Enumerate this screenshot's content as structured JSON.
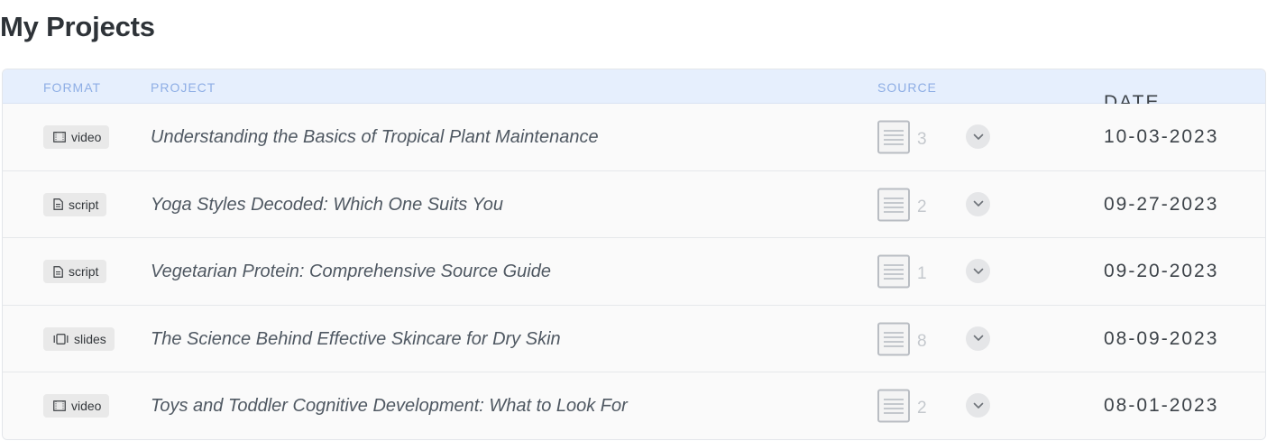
{
  "page": {
    "title": "My Projects"
  },
  "table": {
    "headers": {
      "format": "FORMAT",
      "project": "PROJECT",
      "source": "SOURCE",
      "date": "DATE"
    },
    "rows": [
      {
        "format": "video",
        "format_icon": "film-icon",
        "project": "Understanding the Basics of Tropical Plant Maintenance",
        "source_count": "3",
        "date": "10-03-2023"
      },
      {
        "format": "script",
        "format_icon": "document-icon",
        "project": "Yoga Styles Decoded: Which One Suits You",
        "source_count": "2",
        "date": "09-27-2023"
      },
      {
        "format": "script",
        "format_icon": "document-icon",
        "project": "Vegetarian Protein: Comprehensive Source Guide",
        "source_count": "1",
        "date": "09-20-2023"
      },
      {
        "format": "slides",
        "format_icon": "slides-icon",
        "project": "The Science Behind Effective Skincare for Dry Skin",
        "source_count": "8",
        "date": "08-09-2023"
      },
      {
        "format": "video",
        "format_icon": "film-icon",
        "project": "Toys and Toddler Cognitive Development: What to Look For",
        "source_count": "2",
        "date": "08-01-2023"
      }
    ]
  },
  "colors": {
    "header_bg": "#e6effd",
    "header_text": "#8eaee5",
    "row_bg": "#fafafa",
    "badge_bg": "#e9e9e9"
  }
}
